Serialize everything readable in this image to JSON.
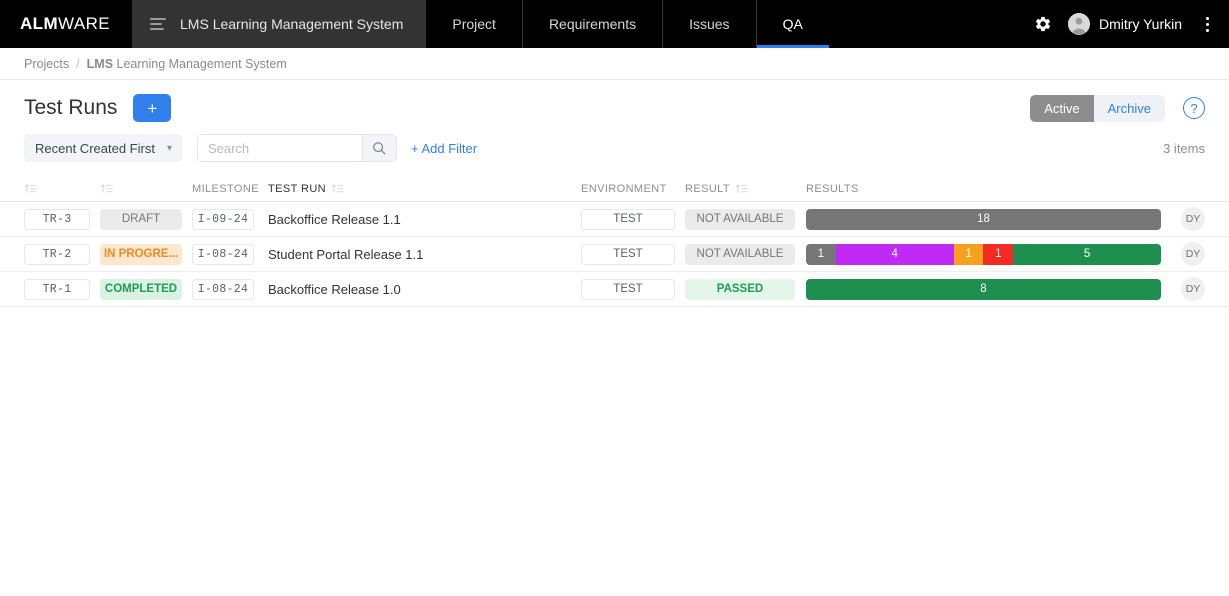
{
  "topbar": {
    "logo_bold": "ALM",
    "logo_rest": "WARE",
    "project_selector": "LMS Learning Management System",
    "nav": [
      {
        "label": "Project",
        "active": false
      },
      {
        "label": "Requirements",
        "active": false
      },
      {
        "label": "Issues",
        "active": false
      },
      {
        "label": "QA",
        "active": true
      }
    ],
    "user_name": "Dmitry Yurkin",
    "gear_icon": "gear-icon",
    "kebab_icon": "more-vertical-icon"
  },
  "breadcrumb": {
    "root": "Projects",
    "separator": "/",
    "current_code": "LMS",
    "current_name": "Learning Management System"
  },
  "page": {
    "title": "Test Runs",
    "add_label": "+",
    "help_label": "?",
    "toggle": {
      "active_label": "Active",
      "archive_label": "Archive",
      "selected": "Active"
    }
  },
  "filters": {
    "sort_label": "Recent Created First",
    "search_placeholder": "Search",
    "search_value": "",
    "add_filter_label": "+ Add Filter",
    "item_count": "3 items"
  },
  "table": {
    "headers": {
      "id": "",
      "status": "",
      "milestone": "MILESTONE",
      "test_run": "TEST RUN",
      "environment": "ENVIRONMENT",
      "result": "RESULT",
      "results": "RESULTS"
    },
    "rows": [
      {
        "id": "TR-3",
        "status": "DRAFT",
        "status_kind": "gray",
        "milestone": "I-09-24",
        "name": "Backoffice Release 1.1",
        "environment": "TEST",
        "result": "NOT AVAILABLE",
        "result_kind": "gray",
        "owner": "DY",
        "bar": [
          {
            "label": "18",
            "value": 18,
            "color": "#767676"
          }
        ]
      },
      {
        "id": "TR-2",
        "status": "IN PROGRE...",
        "status_kind": "orange",
        "milestone": "I-08-24",
        "name": "Student Portal Release 1.1",
        "environment": "TEST",
        "result": "NOT AVAILABLE",
        "result_kind": "gray",
        "owner": "DY",
        "bar": [
          {
            "label": "1",
            "value": 1,
            "color": "#767676"
          },
          {
            "label": "4",
            "value": 4,
            "color": "#bf2bf5"
          },
          {
            "label": "1",
            "value": 1,
            "color": "#f5a11e"
          },
          {
            "label": "1",
            "value": 1,
            "color": "#f42b24"
          },
          {
            "label": "5",
            "value": 5,
            "color": "#1e8f4e"
          }
        ]
      },
      {
        "id": "TR-1",
        "status": "COMPLETED",
        "status_kind": "green",
        "milestone": "I-08-24",
        "name": "Backoffice Release 1.0",
        "environment": "TEST",
        "result": "PASSED",
        "result_kind": "greenlt",
        "owner": "DY",
        "bar": [
          {
            "label": "8",
            "value": 8,
            "color": "#1e8f4e"
          }
        ]
      }
    ]
  },
  "colors": {
    "accent": "#2f80ed",
    "header_bg": "#000000",
    "gray": "#767676",
    "purple": "#bf2bf5",
    "orange": "#f5a11e",
    "red": "#f42b24",
    "green": "#1e8f4e"
  }
}
